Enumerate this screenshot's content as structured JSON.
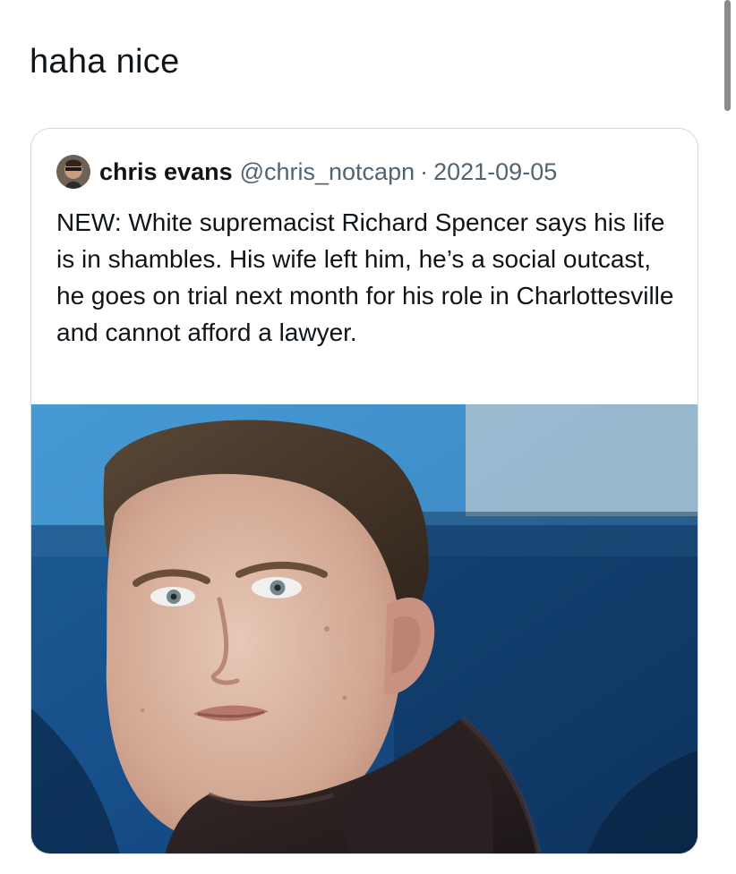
{
  "comment": {
    "text": "haha nice"
  },
  "quoted_tweet": {
    "author_name": "chris evans",
    "handle": "@chris_notcapn",
    "separator": "·",
    "date": "2021-09-05",
    "text": "NEW: White supremacist Richard Spencer says his life is in shambles. His wife left him, he’s a social outcast, he goes on trial next month for his role in Charlottesville and cannot afford a lawyer.",
    "avatar_icon": "user-avatar",
    "photo_icon": "portrait-photo"
  },
  "colors": {
    "text_primary": "#0f1419",
    "text_secondary": "#536471",
    "card_border": "#cfd9de",
    "photo_background_blue": "#2b84c6"
  }
}
